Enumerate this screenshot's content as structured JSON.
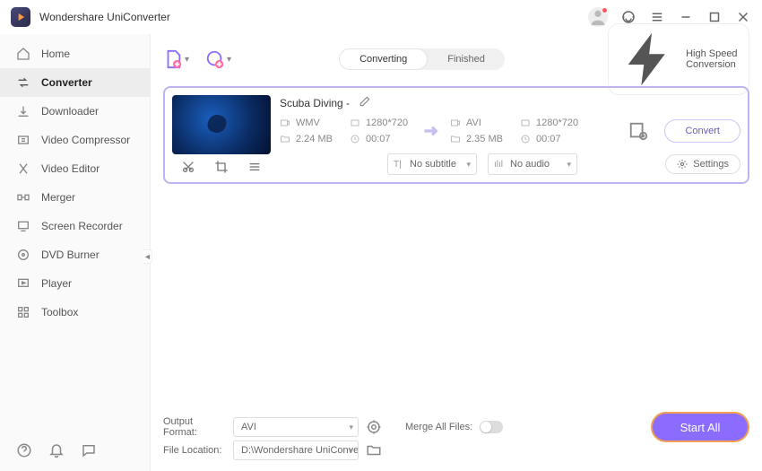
{
  "app": {
    "title": "Wondershare UniConverter"
  },
  "titlebar": {
    "speed_label": "High Speed Conversion"
  },
  "sidebar": {
    "items": [
      {
        "label": "Home"
      },
      {
        "label": "Converter"
      },
      {
        "label": "Downloader"
      },
      {
        "label": "Video Compressor"
      },
      {
        "label": "Video Editor"
      },
      {
        "label": "Merger"
      },
      {
        "label": "Screen Recorder"
      },
      {
        "label": "DVD Burner"
      },
      {
        "label": "Player"
      },
      {
        "label": "Toolbox"
      }
    ]
  },
  "tabs": {
    "converting": "Converting",
    "finished": "Finished"
  },
  "file": {
    "title": "Scuba Diving -",
    "src": {
      "format": "WMV",
      "res": "1280*720",
      "size": "2.24 MB",
      "dur": "00:07"
    },
    "dst": {
      "format": "AVI",
      "res": "1280*720",
      "size": "2.35 MB",
      "dur": "00:07"
    },
    "subtitle": "No subtitle",
    "audio": "No audio",
    "settings_label": "Settings",
    "convert_label": "Convert"
  },
  "bottom": {
    "output_format_label": "Output Format:",
    "output_format_value": "AVI",
    "file_location_label": "File Location:",
    "file_location_value": "D:\\Wondershare UniConverter",
    "merge_label": "Merge All Files:",
    "start_all_label": "Start All"
  }
}
